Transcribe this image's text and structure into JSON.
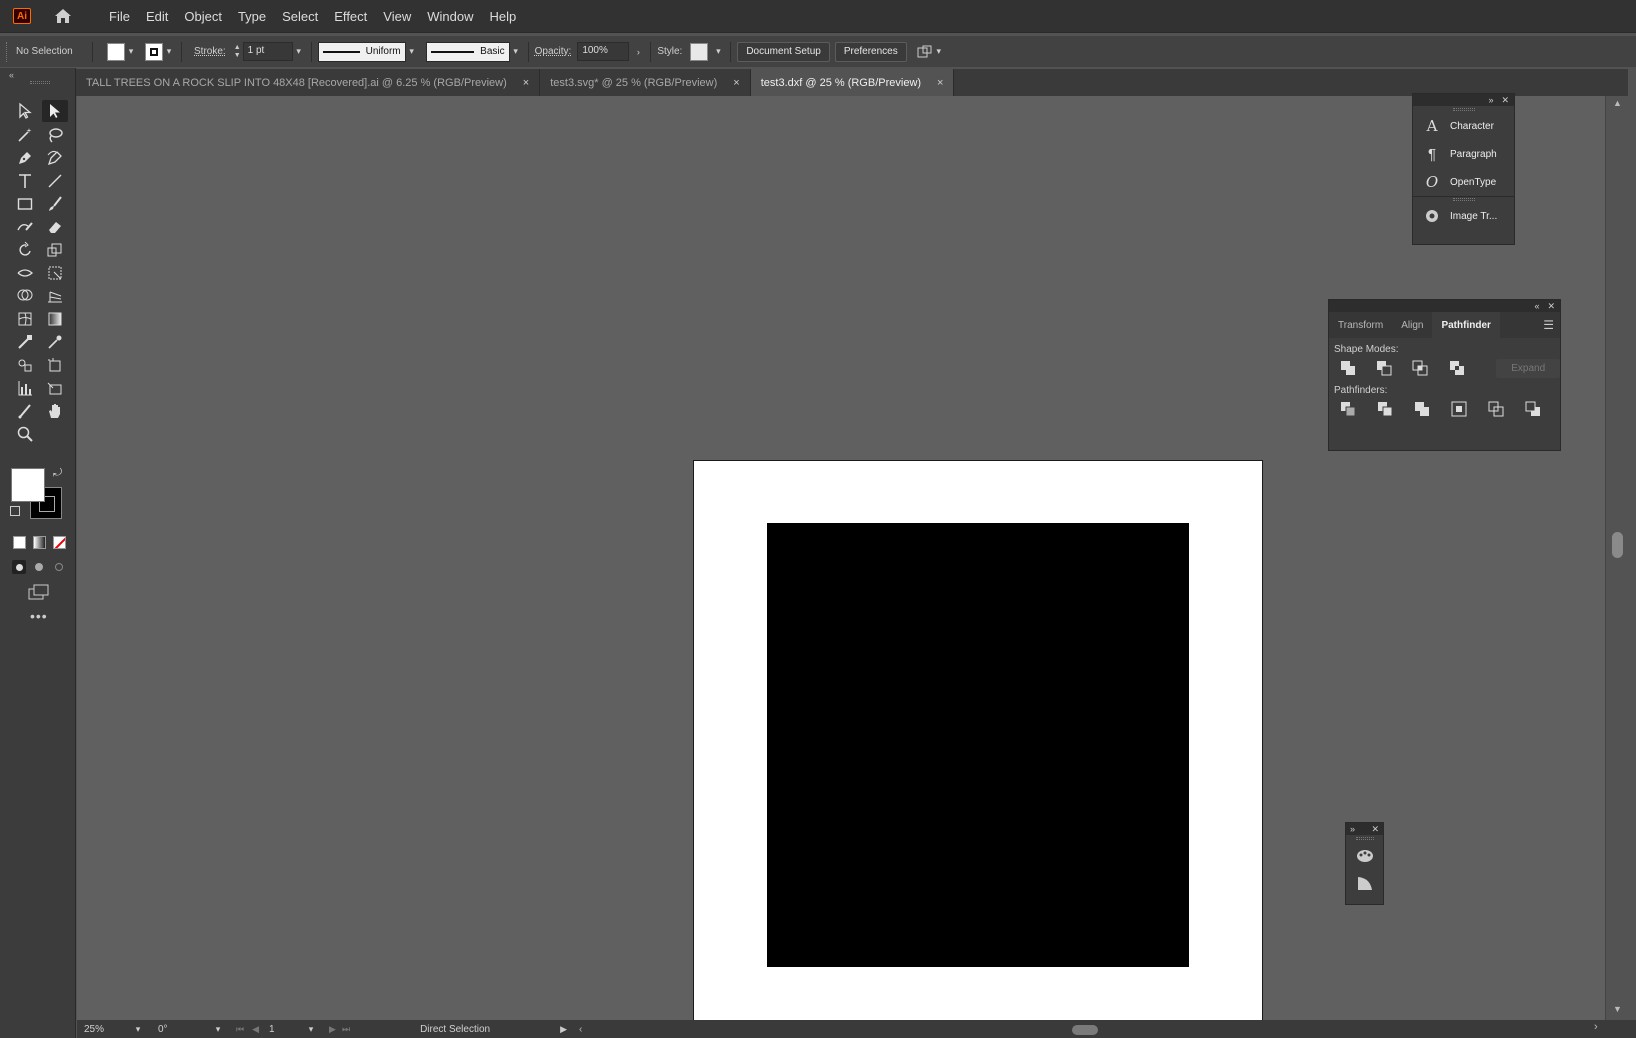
{
  "app": {
    "logo_text": "Ai",
    "brand_color": "#ff6a00"
  },
  "menu": [
    "File",
    "Edit",
    "Object",
    "Type",
    "Select",
    "Effect",
    "View",
    "Window",
    "Help"
  ],
  "control_bar": {
    "selection_label": "No Selection",
    "stroke_label": "Stroke:",
    "stroke_value": "1 pt",
    "profile_label": "Uniform",
    "brush_label": "Basic",
    "opacity_label": "Opacity:",
    "opacity_value": "100%",
    "style_label": "Style:",
    "document_setup": "Document Setup",
    "preferences": "Preferences"
  },
  "tabs": [
    {
      "label": "TALL TREES ON A ROCK SLIP INTO 48X48 [Recovered].ai @ 6.25 % (RGB/Preview)",
      "close": "×"
    },
    {
      "label": "test3.svg* @ 25 % (RGB/Preview)",
      "close": "×"
    },
    {
      "label": "test3.dxf @ 25 % (RGB/Preview)",
      "close": "×",
      "active": true
    }
  ],
  "dock_panel": {
    "items": [
      {
        "label": "Character",
        "icon": "character-icon"
      },
      {
        "label": "Paragraph",
        "icon": "paragraph-icon"
      },
      {
        "label": "OpenType",
        "icon": "opentype-icon"
      },
      {
        "label": "Image Tr...",
        "icon": "image-trace-icon"
      }
    ]
  },
  "pathfinder_panel": {
    "tabs": [
      "Transform",
      "Align",
      "Pathfinder"
    ],
    "active_tab": "Pathfinder",
    "shape_modes_label": "Shape Modes:",
    "pathfinders_label": "Pathfinders:",
    "expand_label": "Expand"
  },
  "status_bar": {
    "zoom": "25%",
    "rotation": "0°",
    "artboard_number": "1",
    "tool_name": "Direct Selection"
  },
  "artboard": {
    "background": "#ffffff",
    "shape_color": "#000000"
  }
}
